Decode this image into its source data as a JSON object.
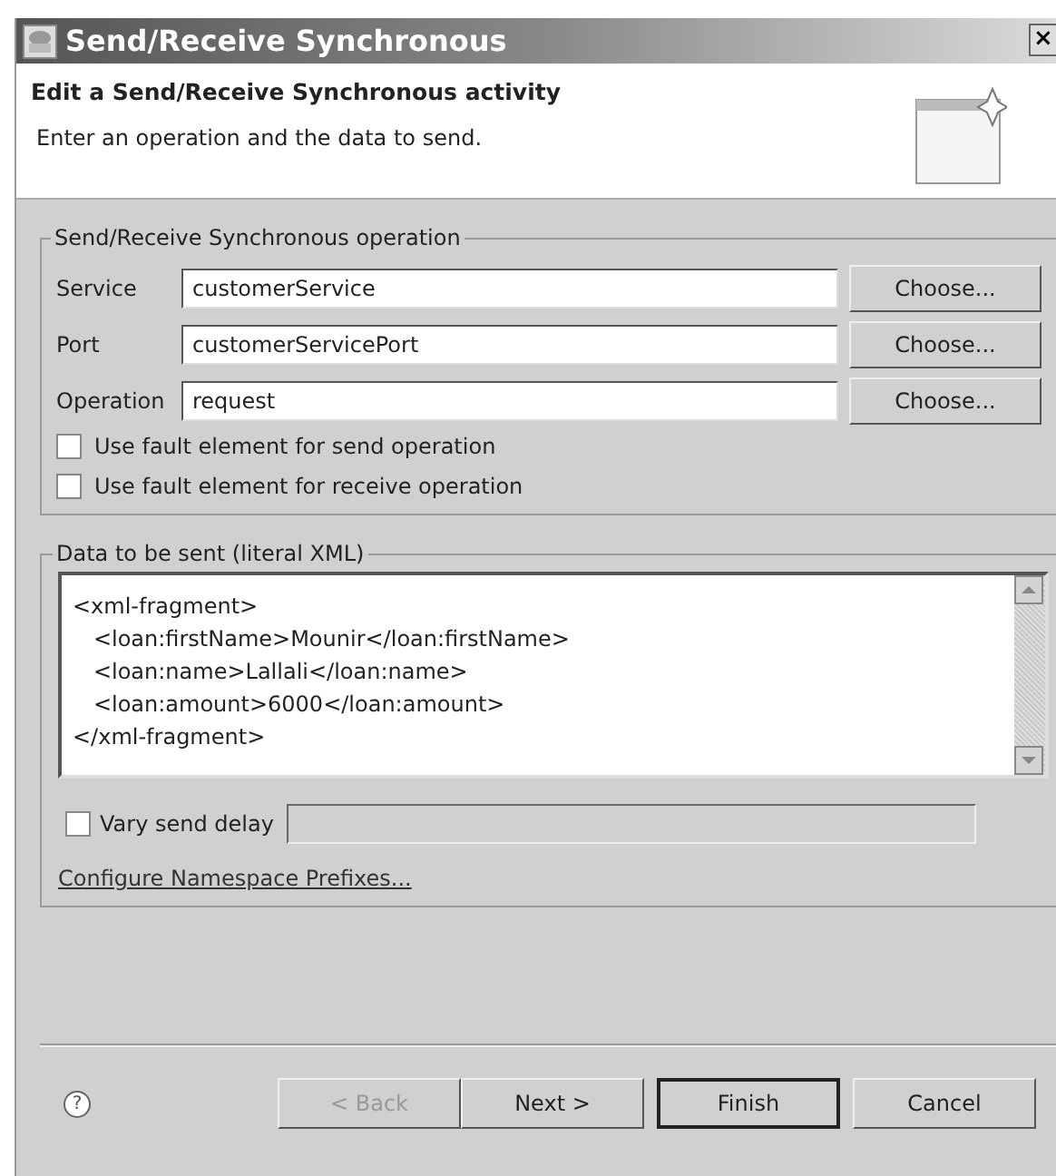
{
  "window": {
    "title": "Send/Receive Synchronous",
    "close": "×"
  },
  "header": {
    "title": "Edit a Send/Receive Synchronous activity",
    "description": "Enter an operation and the data to send."
  },
  "operation_group": {
    "title": "Send/Receive Synchronous operation",
    "fields": [
      {
        "label": "Service",
        "value": "customerService",
        "button": "Choose..."
      },
      {
        "label": "Port",
        "value": "customerServicePort",
        "button": "Choose..."
      },
      {
        "label": "Operation",
        "value": "request",
        "button": "Choose..."
      }
    ],
    "checkboxes": [
      {
        "label": "Use fault element for send operation",
        "checked": false
      },
      {
        "label": "Use fault element for receive operation",
        "checked": false
      }
    ]
  },
  "data_group": {
    "title": "Data to be sent (literal XML)",
    "xml_lines": [
      "<xml-fragment>",
      "   <loan:firstName>Mounir</loan:firstName>",
      "   <loan:name>Lallali</loan:name>",
      "   <loan:amount>6000</loan:amount>",
      "</xml-fragment>"
    ],
    "vary_delay": {
      "label": "Vary send delay",
      "checked": false
    },
    "link": "Configure Namespace Prefixes..."
  },
  "buttons": [
    {
      "label": "< Back",
      "disabled": true,
      "default": false
    },
    {
      "label": "Next >",
      "disabled": false,
      "default": false
    },
    {
      "label": "Finish",
      "disabled": false,
      "default": true
    },
    {
      "label": "Cancel",
      "disabled": false,
      "default": false
    }
  ],
  "help": "?"
}
